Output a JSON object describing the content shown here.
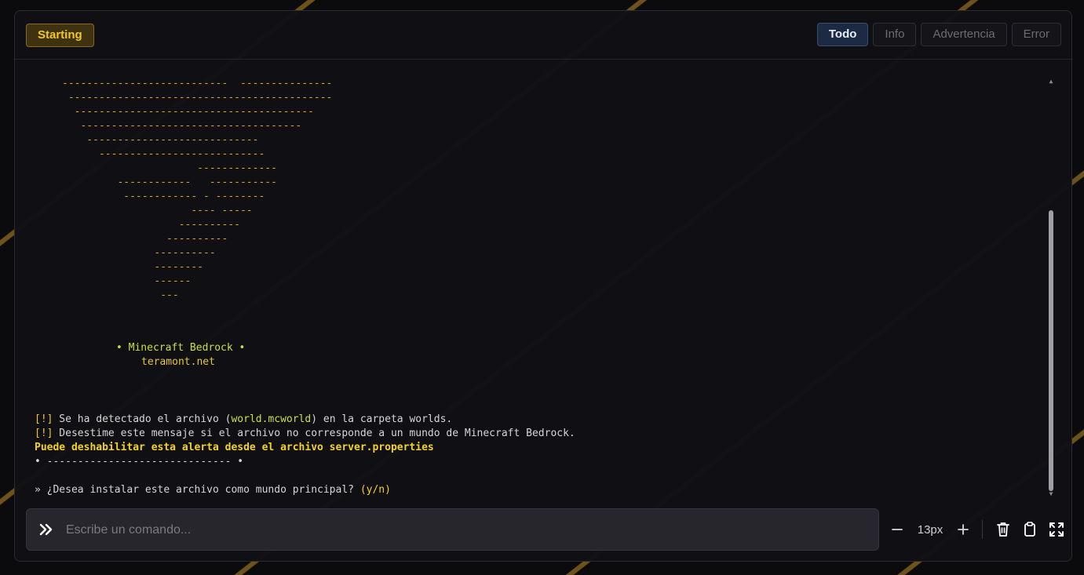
{
  "header": {
    "status": "Starting",
    "filters": [
      {
        "label": "Todo",
        "active": true
      },
      {
        "label": "Info",
        "active": false
      },
      {
        "label": "Advertencia",
        "active": false
      },
      {
        "label": "Error",
        "active": false
      }
    ]
  },
  "console": {
    "ascii_art": "---------------------------  ---------------\n -------------------------------------------\n  ---------------------------------------\n   ------------------------------------\n    ----------------------------\n      ---------------------------\n                      -------------\n         ------------   -----------\n          ------------ - --------\n                     ---- -----\n                   ----------\n                 ----------\n               ----------\n               --------\n               ------\n                ---",
    "brand": "• Minecraft Bedrock •",
    "site": "teramont.net",
    "line1": {
      "tag": "[!]",
      "pre": " Se ha detectado el archivo (",
      "file": "world.mcworld",
      "post": ") en la carpeta worlds."
    },
    "line2": {
      "tag": "[!]",
      "text": " Desestime este mensaje si el archivo no corresponde a un mundo de Minecraft Bedrock."
    },
    "line3": "Puede deshabilitar esta alerta desde el archivo server.properties",
    "line4": "• ------------------------------ •",
    "line5": {
      "text": "» ¿Desea instalar este archivo como mundo principal? ",
      "yn": "(y/n)"
    }
  },
  "input": {
    "placeholder": "Escribe un comando...",
    "value": ""
  },
  "toolbar": {
    "font_size": "13px"
  },
  "icons": {
    "prompt": "double-chevron-right-icon",
    "decrease": "minus-icon",
    "increase": "plus-icon",
    "clear": "trash-icon",
    "copy": "clipboard-icon",
    "fullscreen": "expand-icon"
  },
  "colors": {
    "accent_orange": "#e3a423",
    "accent_yellow": "#f4d320",
    "accent_lime": "#c7e03f",
    "active_filter": "#1d2a44"
  }
}
